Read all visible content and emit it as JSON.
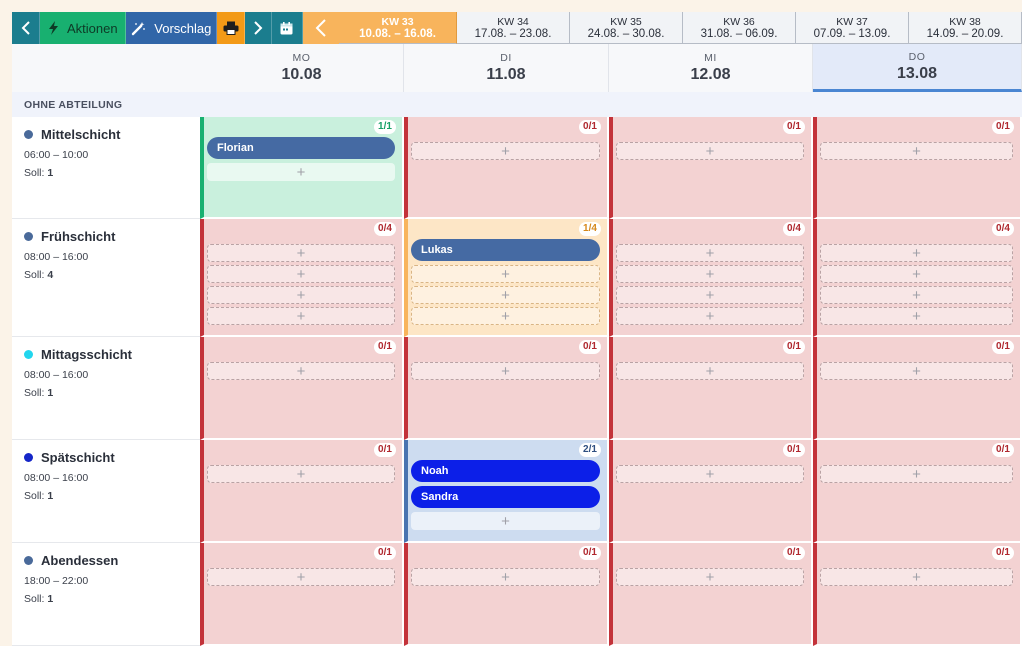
{
  "toolbar": {
    "aktionen_label": "Aktionen",
    "vorschlag_label": "Vorschlag"
  },
  "weeks": [
    {
      "label": "KW 33",
      "range": "10.08. – 16.08.",
      "current": true
    },
    {
      "label": "KW 34",
      "range": "17.08. – 23.08."
    },
    {
      "label": "KW 35",
      "range": "24.08. – 30.08."
    },
    {
      "label": "KW 36",
      "range": "31.08. – 06.09."
    },
    {
      "label": "KW 37",
      "range": "07.09. – 13.09."
    },
    {
      "label": "KW 38",
      "range": "14.09. – 20.09."
    }
  ],
  "days": [
    {
      "name": "MO",
      "date": "10.08"
    },
    {
      "name": "DI",
      "date": "11.08"
    },
    {
      "name": "MI",
      "date": "12.08"
    },
    {
      "name": "DO",
      "date": "13.08",
      "today": true
    }
  ],
  "department": "OHNE ABTEILUNG",
  "colors": {
    "accent_teal": "#1b7d8e",
    "aktionen_green": "#18b070",
    "vorschlag_blue": "#3166a8",
    "print_orange": "#f39a17",
    "current_week": "#f8b45c",
    "understaffed": "#c3333a",
    "employee_steel": "#456aa3",
    "employee_royal": "#0c1fe8"
  },
  "shifts": [
    {
      "name": "Mittelschicht",
      "time": "06:00 – 10:00",
      "soll_label": "Soll:",
      "soll": "1",
      "dot_color": "#4a6a9a",
      "cells": [
        {
          "status": "green",
          "count": "1/1",
          "employees": [
            {
              "name": "Florian",
              "color": "steel"
            }
          ],
          "open_slots": 1
        },
        {
          "status": "red",
          "count": "0/1",
          "employees": [],
          "open_slots": 1
        },
        {
          "status": "red",
          "count": "0/1",
          "employees": [],
          "open_slots": 1
        },
        {
          "status": "red",
          "count": "0/1",
          "employees": [],
          "open_slots": 1
        }
      ]
    },
    {
      "name": "Frühschicht",
      "time": "08:00 – 16:00",
      "soll_label": "Soll:",
      "soll": "4",
      "dot_color": "#4a6a9a",
      "cells": [
        {
          "status": "red",
          "count": "0/4",
          "employees": [],
          "open_slots": 4
        },
        {
          "status": "orange",
          "count": "1/4",
          "employees": [
            {
              "name": "Lukas",
              "color": "steel"
            }
          ],
          "open_slots": 3
        },
        {
          "status": "red",
          "count": "0/4",
          "employees": [],
          "open_slots": 4
        },
        {
          "status": "red",
          "count": "0/4",
          "employees": [],
          "open_slots": 4
        }
      ]
    },
    {
      "name": "Mittagsschicht",
      "time": "08:00 – 16:00",
      "soll_label": "Soll:",
      "soll": "1",
      "dot_color": "#22d6ee",
      "cells": [
        {
          "status": "red",
          "count": "0/1",
          "employees": [],
          "open_slots": 1
        },
        {
          "status": "red",
          "count": "0/1",
          "employees": [],
          "open_slots": 1
        },
        {
          "status": "red",
          "count": "0/1",
          "employees": [],
          "open_slots": 1
        },
        {
          "status": "red",
          "count": "0/1",
          "employees": [],
          "open_slots": 1
        }
      ]
    },
    {
      "name": "Spätschicht",
      "time": "08:00 – 16:00",
      "soll_label": "Soll:",
      "soll": "1",
      "dot_color": "#1526c8",
      "cells": [
        {
          "status": "red",
          "count": "0/1",
          "employees": [],
          "open_slots": 1
        },
        {
          "status": "blue",
          "count": "2/1",
          "employees": [
            {
              "name": "Noah",
              "color": "royal"
            },
            {
              "name": "Sandra",
              "color": "royal"
            }
          ],
          "open_slots": 1
        },
        {
          "status": "red",
          "count": "0/1",
          "employees": [],
          "open_slots": 1
        },
        {
          "status": "red",
          "count": "0/1",
          "employees": [],
          "open_slots": 1
        }
      ]
    },
    {
      "name": "Abendessen",
      "time": "18:00 – 22:00",
      "soll_label": "Soll:",
      "soll": "1",
      "dot_color": "#4a6a9a",
      "cells": [
        {
          "status": "red",
          "count": "0/1",
          "employees": [],
          "open_slots": 1
        },
        {
          "status": "red",
          "count": "0/1",
          "employees": [],
          "open_slots": 1
        },
        {
          "status": "red",
          "count": "0/1",
          "employees": [],
          "open_slots": 1
        },
        {
          "status": "red",
          "count": "0/1",
          "employees": [],
          "open_slots": 1
        }
      ]
    }
  ],
  "slot_plus": "+"
}
